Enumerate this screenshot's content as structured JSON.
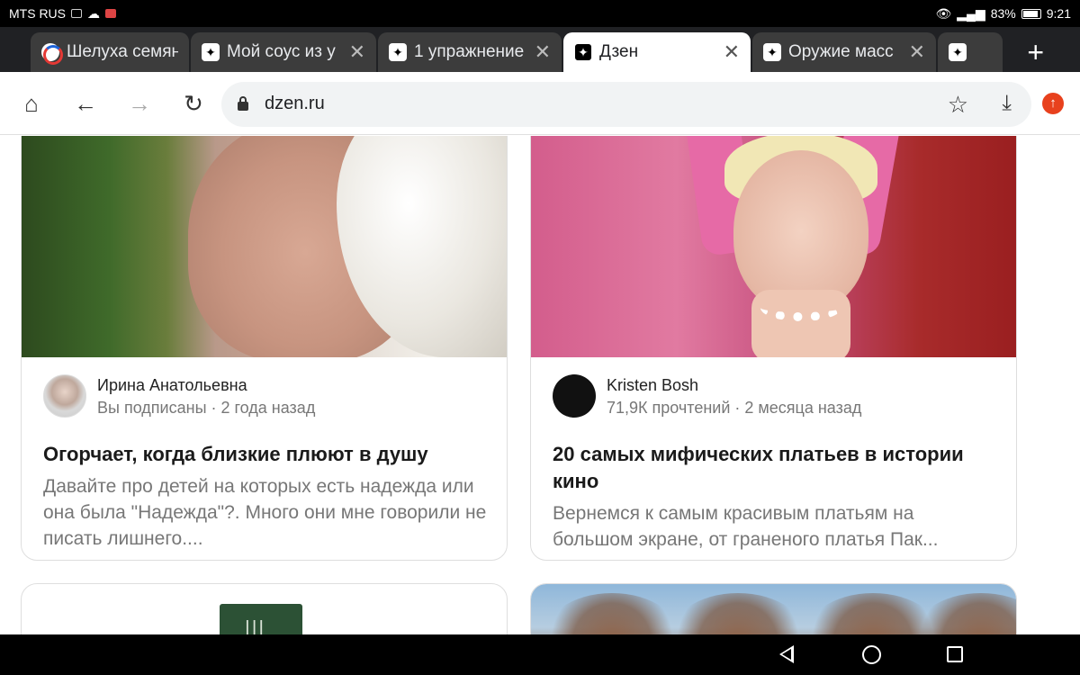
{
  "status_bar": {
    "carrier": "MTS RUS",
    "battery": "83%",
    "time": "9:21"
  },
  "tabs": [
    {
      "title": "Шелуха семян",
      "icon": "opera-icon",
      "active": false
    },
    {
      "title": "Мой соус из у",
      "icon": "zen-icon",
      "active": false
    },
    {
      "title": "1 упражнение",
      "icon": "zen-icon",
      "active": false
    },
    {
      "title": "Дзен",
      "icon": "zen-icon",
      "active": true
    },
    {
      "title": "Оружие масс",
      "icon": "zen-icon",
      "active": false
    },
    {
      "title": "",
      "icon": "zen-icon",
      "active": false
    }
  ],
  "toolbar": {
    "url": "dzen.ru"
  },
  "cards": [
    {
      "author": "Ирина Анатольевна",
      "sub": "Вы подписаны · 2 года назад",
      "headline": "Огорчает, когда близкие плюют в душу",
      "snippet": "Давайте про детей на которых есть надежда или она была \"Надежда\"?. Много они мне говорили не писать лишнего...."
    },
    {
      "author": "Kristen Bosh",
      "sub": "71,9К прочтений · 2 месяца назад",
      "headline": "20 самых мифических платьев в истории кино",
      "snippet": "Вернемся к самым красивым платьям на большом экране, от граненого платья Пак..."
    }
  ]
}
